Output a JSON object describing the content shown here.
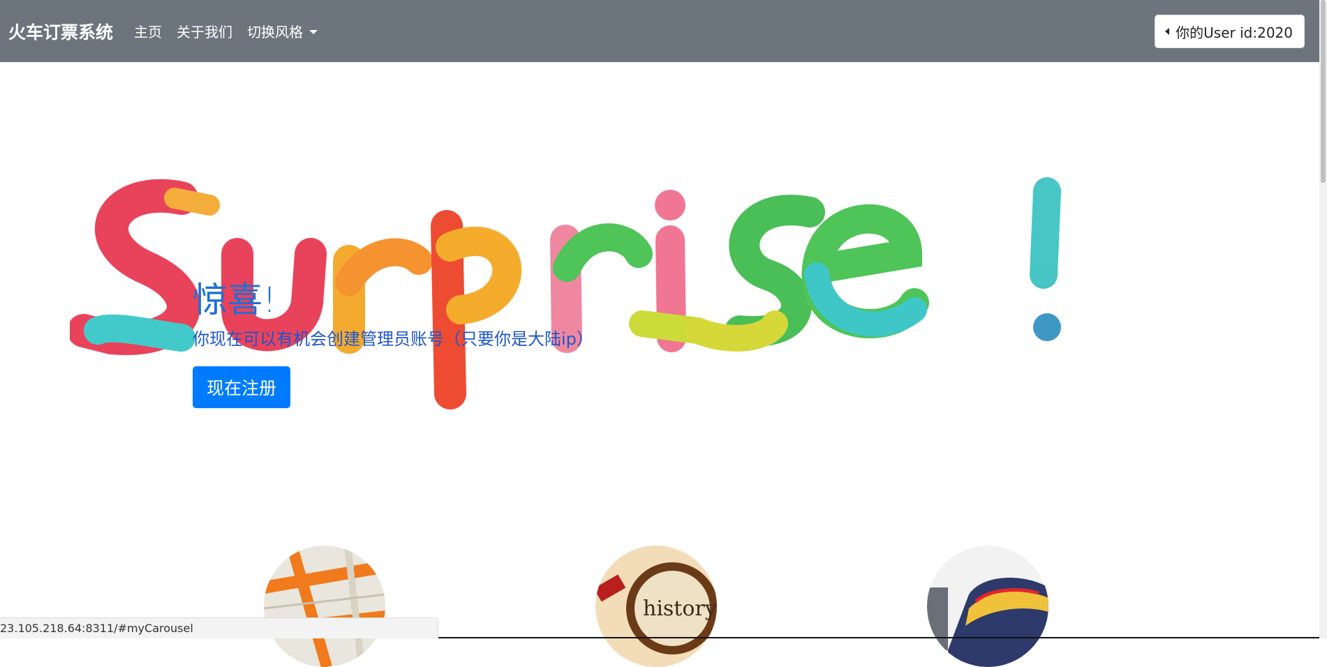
{
  "navbar": {
    "brand": "火车订票系统",
    "links": [
      "主页",
      "关于我们"
    ],
    "dropdown_label": "切换风格",
    "user_button_label": "你的User id:2020",
    "bg_color": "#6c757d"
  },
  "hero": {
    "art_text": "Surprise !",
    "title": "惊喜!",
    "subtitle": "你现在可以有机会创建管理员账号（只要你是大陆ip）",
    "register_button": "现在注册"
  },
  "features": {
    "images": [
      "map-image",
      "history-magnifier-image",
      "train-image"
    ],
    "magnifier_text": "history"
  },
  "status_bar": {
    "url": "23.105.218.64:8311/#myCarousel"
  },
  "colors": {
    "primary": "#007bff",
    "hero_text": "#1e6fd6"
  }
}
